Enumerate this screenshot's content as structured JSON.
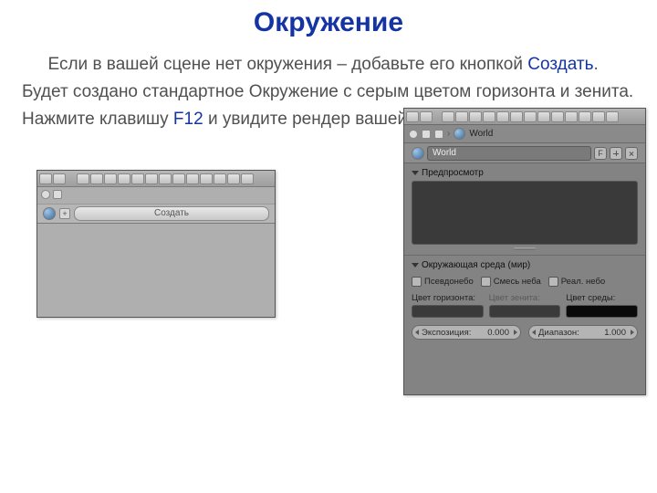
{
  "title": "Окружение",
  "para": {
    "t1": "Если в вашей сцене нет окружения – добавьте его кнопкой ",
    "b1": "Создать",
    "t2": ". Будет создано стандартное Окружение с серым цветом горизонта и зенита. Нажмите клавишу ",
    "b2": "F12",
    "t3": " и увидите рендер вашей сцены."
  },
  "left_panel": {
    "create": "Создать"
  },
  "right_panel": {
    "breadcrumb": "World",
    "id_field": "World",
    "id_f": "F",
    "sect_preview": "Предпросмотр",
    "sect_env": "Окружающая среда (мир)",
    "cb_pseudo": "Псевдонебо",
    "cb_blend": "Смесь неба",
    "cb_real": "Реал. небо",
    "lbl_horizon": "Цвет горизонта:",
    "lbl_zenith": "Цвет зенита:",
    "lbl_ambient": "Цвет среды:",
    "exposure_label": "Экспозиция:",
    "exposure_val": "0.000",
    "range_label": "Диапазон:",
    "range_val": "1.000",
    "colors": {
      "horizon": "#3a3a3a",
      "zenith": "#3a3a3a",
      "ambient": "#0a0a0a"
    }
  }
}
